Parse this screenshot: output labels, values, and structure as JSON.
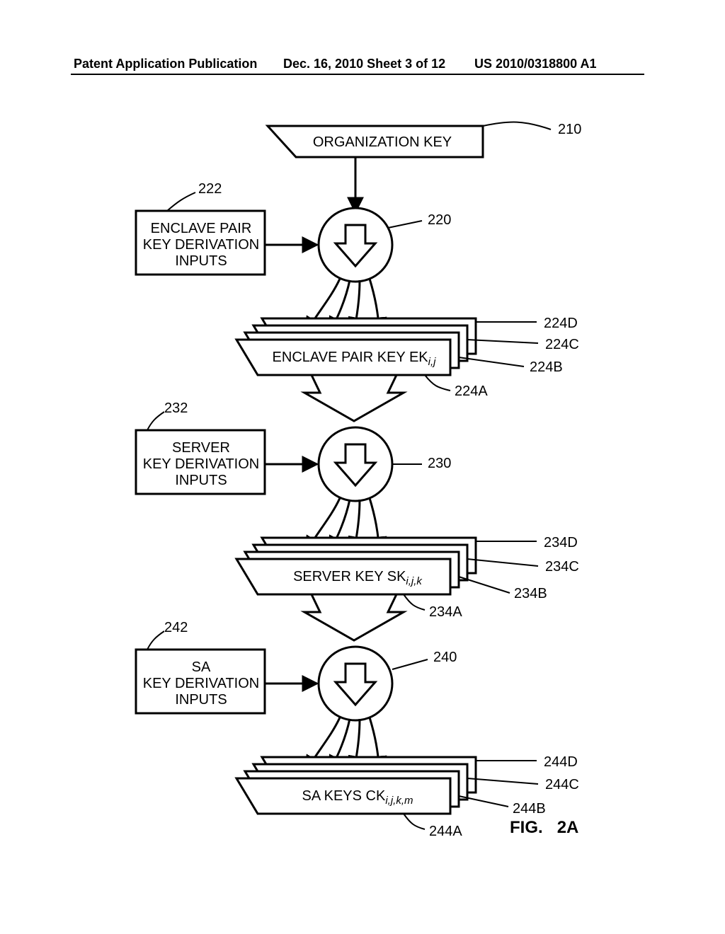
{
  "header": {
    "left": "Patent Application Publication",
    "mid": "Dec. 16, 2010  Sheet 3 of 12",
    "right": "US 2010/0318800 A1"
  },
  "blocks": {
    "org_key": "ORGANIZATION KEY",
    "enclave_inputs_l1": "ENCLAVE PAIR",
    "enclave_inputs_l2": "KEY DERIVATION",
    "enclave_inputs_l3": "INPUTS",
    "enclave_key_prefix": "ENCLAVE PAIR KEY EK",
    "enclave_key_sub": "i,j",
    "server_inputs_l1": "SERVER",
    "server_inputs_l2": "KEY DERIVATION",
    "server_inputs_l3": "INPUTS",
    "server_key_prefix": "SERVER KEY SK",
    "server_key_sub": "i,j,k",
    "sa_inputs_l1": "SA",
    "sa_inputs_l2": "KEY DERIVATION",
    "sa_inputs_l3": "INPUTS",
    "sa_key_prefix": "SA KEYS CK",
    "sa_key_sub": "i,j,k,m"
  },
  "refs": {
    "r210": "210",
    "r222": "222",
    "r220": "220",
    "r224a": "224A",
    "r224b": "224B",
    "r224c": "224C",
    "r224d": "224D",
    "r232": "232",
    "r230": "230",
    "r234a": "234A",
    "r234b": "234B",
    "r234c": "234C",
    "r234d": "234D",
    "r242": "242",
    "r240": "240",
    "r244a": "244A",
    "r244b": "244B",
    "r244c": "244C",
    "r244d": "244D"
  },
  "figure": {
    "prefix": "FIG.",
    "num": "2A"
  }
}
